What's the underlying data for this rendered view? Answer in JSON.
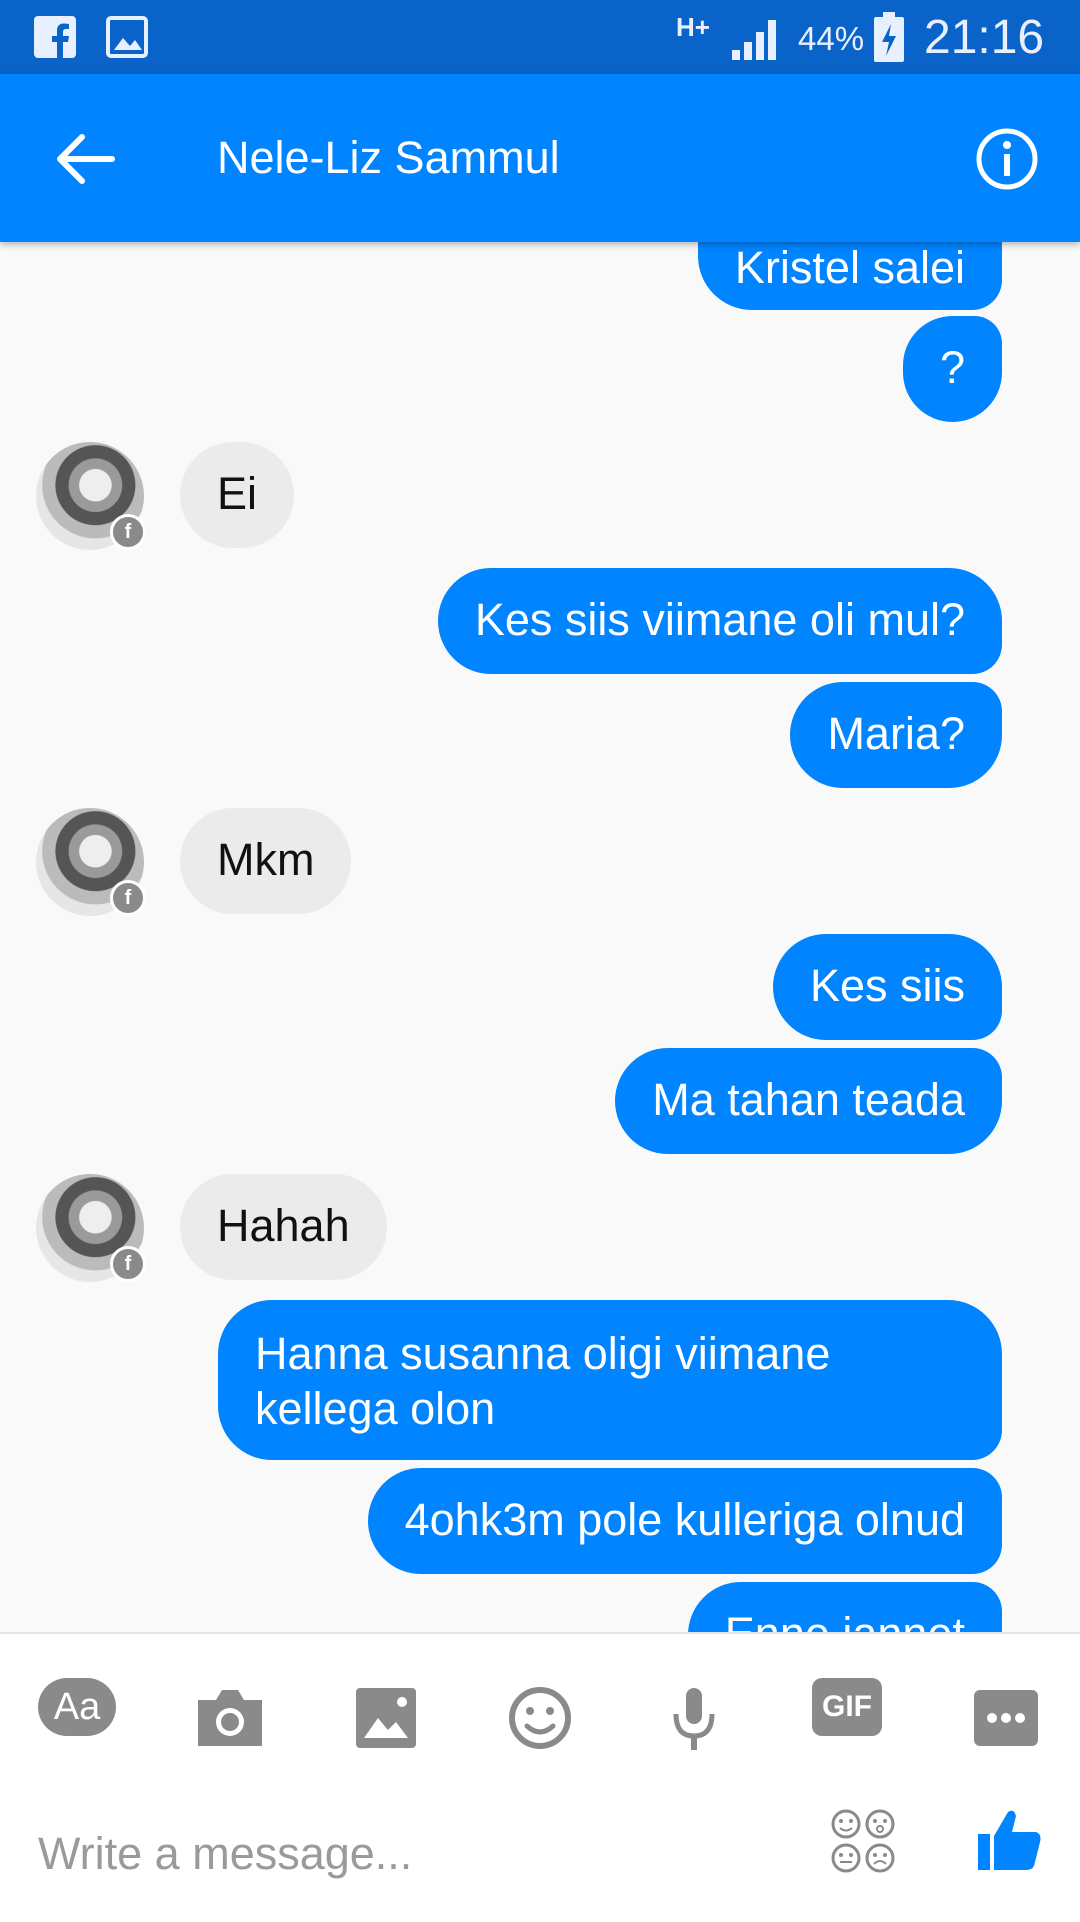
{
  "status_bar": {
    "network": "H+",
    "battery_percent": "44%",
    "time": "21:16"
  },
  "header": {
    "title": "Nele-Liz Sammul"
  },
  "messages": [
    {
      "direction": "out",
      "text": "Kristel salei"
    },
    {
      "direction": "out",
      "text": "?"
    },
    {
      "direction": "in",
      "text": "Ei"
    },
    {
      "direction": "out",
      "text": "Kes siis viimane oli mul?"
    },
    {
      "direction": "out",
      "text": "Maria?"
    },
    {
      "direction": "in",
      "text": "Mkm"
    },
    {
      "direction": "out",
      "text": "Kes siis"
    },
    {
      "direction": "out",
      "text": "Ma tahan teada"
    },
    {
      "direction": "in",
      "text": "Hahah"
    },
    {
      "direction": "out",
      "text": "Hanna susanna oligi viimane kellega olon"
    },
    {
      "direction": "out",
      "text": "4ohk3m pole kulleriga olnud"
    },
    {
      "direction": "out",
      "text": "Enne jannet"
    }
  ],
  "composer": {
    "text_format_label": "Aa",
    "gif_label": "GIF",
    "placeholder": "Write a message..."
  },
  "colors": {
    "status_bar": "#0a63c8",
    "accent": "#0084ff",
    "incoming_bubble": "#ebebeb",
    "icon_gray": "#8a8a8a"
  },
  "icons": [
    "facebook-icon",
    "gallery-icon",
    "signal-icon",
    "battery-icon",
    "back-arrow-icon",
    "info-icon",
    "camera-icon",
    "image-icon",
    "emoji-icon",
    "microphone-icon",
    "more-icon",
    "sticker-icon",
    "thumbs-up-icon"
  ]
}
